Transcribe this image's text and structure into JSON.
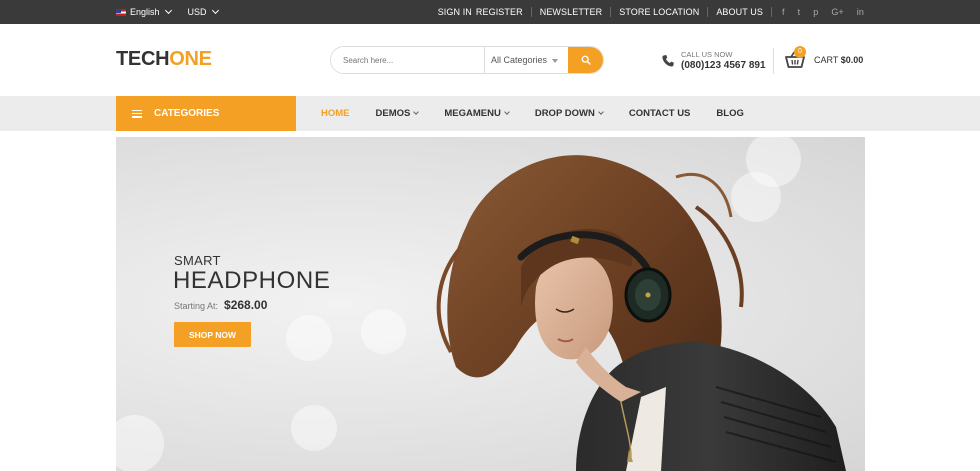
{
  "topbar": {
    "language": "English",
    "currency": "USD",
    "links": [
      "SIGN IN",
      "REGISTER",
      "NEWSLETTER",
      "STORE LOCATION",
      "ABOUT US"
    ],
    "social_icons": [
      "facebook-icon",
      "twitter-icon",
      "pinterest-icon",
      "google-plus-icon",
      "linkedin-icon"
    ],
    "social_glyphs": [
      "f",
      "t",
      "p",
      "G+",
      "in"
    ]
  },
  "header": {
    "logo_part1": "TECH",
    "logo_part2": "ONE",
    "search_placeholder": "Search here...",
    "category_select": "All Categories",
    "phone_label": "CALL US NOW",
    "phone_number": "(080)123 4567 891",
    "cart_count": "0",
    "cart_label": "CART",
    "cart_total": "$0.00"
  },
  "nav": {
    "categories_label": "CATEGORIES",
    "items": [
      {
        "label": "HOME",
        "dropdown": false,
        "active": true
      },
      {
        "label": "DEMOS",
        "dropdown": true,
        "active": false
      },
      {
        "label": "MEGAMENU",
        "dropdown": true,
        "active": false
      },
      {
        "label": "DROP DOWN",
        "dropdown": true,
        "active": false
      },
      {
        "label": "CONTACT US",
        "dropdown": false,
        "active": false
      },
      {
        "label": "BLOG",
        "dropdown": false,
        "active": false
      }
    ]
  },
  "hero": {
    "subtitle": "SMART",
    "title": "HEADPHONE",
    "price_label": "Starting At:",
    "price_value": "$268.00",
    "cta_label": "SHOP NOW"
  },
  "colors": {
    "accent": "#f4a025",
    "topbar_bg": "#3a3a3a",
    "navbar_bg": "#ececec"
  }
}
